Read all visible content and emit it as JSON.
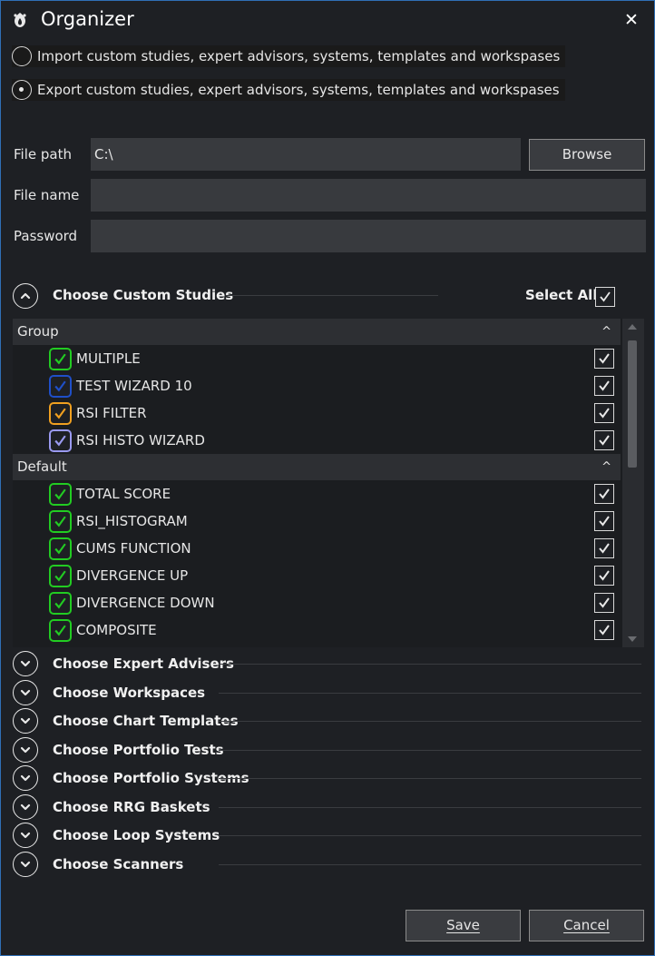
{
  "window": {
    "title": "Organizer"
  },
  "mode": {
    "import_label": "Import custom studies, expert advisors, systems, templates and workspases",
    "export_label": "Export custom studies, expert advisors, systems, templates and workspases",
    "selected": "export"
  },
  "form": {
    "file_path_label": "File path",
    "file_path_value": "C:\\",
    "browse_label": "Browse",
    "file_name_label": "File name",
    "file_name_value": "",
    "password_label": "Password",
    "password_value": ""
  },
  "custom_studies": {
    "title": "Choose Custom Studies",
    "select_all_label": "Select All",
    "select_all_checked": true,
    "groups": [
      {
        "name": "Group",
        "items": [
          {
            "name": "MULTIPLE",
            "color": "#22cc22",
            "checked": true
          },
          {
            "name": "TEST WIZARD 10",
            "color": "#1f4fc8",
            "checked": true
          },
          {
            "name": "RSI FILTER",
            "color": "#f0a020",
            "checked": true
          },
          {
            "name": "RSI HISTO WIZARD",
            "color": "#9a9af0",
            "checked": true
          }
        ]
      },
      {
        "name": "Default",
        "items": [
          {
            "name": "TOTAL SCORE",
            "color": "#22cc22",
            "checked": true
          },
          {
            "name": "RSI_HISTOGRAM",
            "color": "#22cc22",
            "checked": true
          },
          {
            "name": "CUMS FUNCTION",
            "color": "#22cc22",
            "checked": true
          },
          {
            "name": "DIVERGENCE UP",
            "color": "#22cc22",
            "checked": true
          },
          {
            "name": "DIVERGENCE DOWN",
            "color": "#22cc22",
            "checked": true
          },
          {
            "name": "COMPOSITE",
            "color": "#22cc22",
            "checked": true
          }
        ]
      }
    ]
  },
  "collapsed_sections": [
    {
      "title": "Choose Expert Advisers"
    },
    {
      "title": "Choose Workspaces"
    },
    {
      "title": "Choose Chart Templates"
    },
    {
      "title": "Choose Portfolio Tests"
    },
    {
      "title": "Choose Portfolio Systems"
    },
    {
      "title": "Choose RRG Baskets"
    },
    {
      "title": "Choose Loop Systems"
    },
    {
      "title": "Choose Scanners"
    }
  ],
  "footer": {
    "save_label": "Save",
    "cancel_label": "Cancel"
  },
  "icons": {
    "app": "organizer-icon",
    "close": "close-icon",
    "expand": "chevron-down-icon",
    "collapse": "chevron-up-icon",
    "check": "checkmark-icon"
  }
}
